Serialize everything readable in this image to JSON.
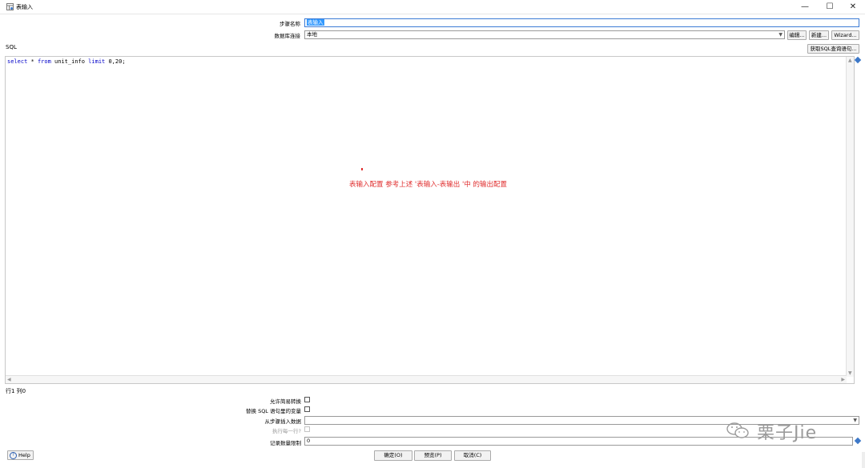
{
  "window": {
    "title": "表输入",
    "minimize_glyph": "—",
    "maximize_glyph": "☐",
    "close_glyph": "✕"
  },
  "form": {
    "step_name_label": "步骤名称",
    "step_name_value": "表输入",
    "db_connection_label": "数据库连接",
    "db_connection_value": "本地",
    "edit_button": "编辑...",
    "new_button": "新建...",
    "wizard_button": "Wizard...",
    "get_sql_button": "获取SQL查询语句..."
  },
  "sql": {
    "label": "SQL",
    "code": {
      "kw1": "select",
      "t1": " * ",
      "kw2": "from",
      "t2": " unit_info ",
      "kw3": "limit",
      "t3": " 0,20;"
    }
  },
  "annotation": {
    "text": "表输入配置 参考上述 '表输入-表输出 '中 的输出配置",
    "color": "#e03030"
  },
  "status": {
    "position": "行1 列0"
  },
  "options": {
    "lazy_conversion_label": "允许简易转换",
    "replace_variables_label": "替换 SQL 语句里的变量",
    "insert_from_step_label": "从步骤插入数据",
    "execute_each_row_label": "执行每一行?",
    "limit_label": "记录数量限制",
    "limit_value": "0"
  },
  "buttons": {
    "help": "Help",
    "ok": "确定(O)",
    "preview": "预览(P)",
    "cancel": "取消(C)"
  },
  "watermark": {
    "text": "栗子Jie"
  },
  "icons": {
    "title": "table-input-icon",
    "variable": "variable-diamond-icon",
    "help": "help-circle-icon",
    "watermark": "wechat-icon"
  }
}
